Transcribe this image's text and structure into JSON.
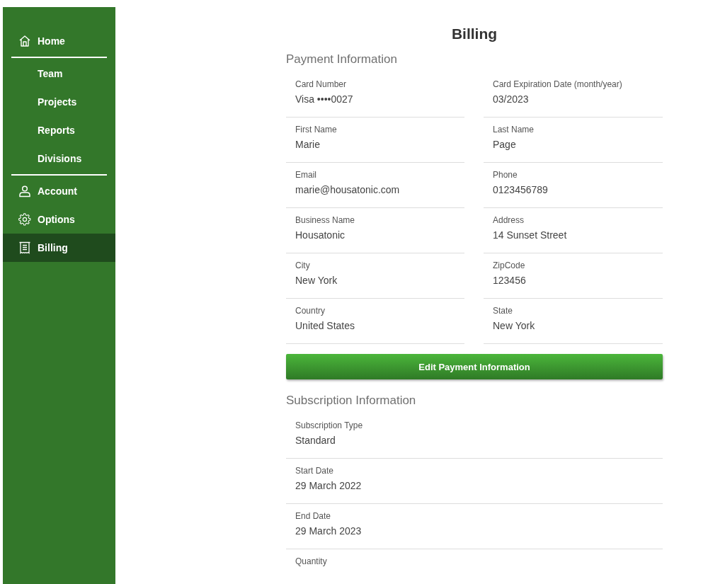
{
  "sidebar": {
    "sections": [
      {
        "items": [
          {
            "label": "Home",
            "kind": "home",
            "selected": false
          }
        ]
      },
      {
        "items": [
          {
            "label": "Team",
            "kind": "plain",
            "selected": false
          },
          {
            "label": "Projects",
            "kind": "plain",
            "selected": false
          },
          {
            "label": "Reports",
            "kind": "plain",
            "selected": false
          },
          {
            "label": "Divisions",
            "kind": "plain",
            "selected": false
          }
        ]
      },
      {
        "items": [
          {
            "label": "Account",
            "kind": "person",
            "selected": false
          },
          {
            "label": "Options",
            "kind": "gear",
            "selected": false
          },
          {
            "label": "Billing",
            "kind": "receipt",
            "selected": true
          }
        ]
      }
    ]
  },
  "page_title": "Billing",
  "payment": {
    "heading": "Payment Information",
    "fields": [
      {
        "label": "Card Number",
        "value": "Visa ••••0027"
      },
      {
        "label": "Card Expiration Date (month/year)",
        "value": "03/2023"
      },
      {
        "label": "First Name",
        "value": "Marie"
      },
      {
        "label": "Last Name",
        "value": "Page"
      },
      {
        "label": "Email",
        "value": "marie@housatonic.com"
      },
      {
        "label": "Phone",
        "value": "0123456789"
      },
      {
        "label": "Business Name",
        "value": "Housatonic"
      },
      {
        "label": "Address",
        "value": "14 Sunset Street"
      },
      {
        "label": "City",
        "value": "New York"
      },
      {
        "label": "ZipCode",
        "value": "123456"
      },
      {
        "label": "Country",
        "value": "United States"
      },
      {
        "label": "State",
        "value": "New York"
      }
    ],
    "button": "Edit Payment Information"
  },
  "subscription": {
    "heading": "Subscription Information",
    "fields": [
      {
        "label": "Subscription Type",
        "value": "Standard"
      },
      {
        "label": "Start Date",
        "value": "29 March 2022"
      },
      {
        "label": "End Date",
        "value": "29 March 2023"
      },
      {
        "label": "Quantity"
      }
    ]
  }
}
